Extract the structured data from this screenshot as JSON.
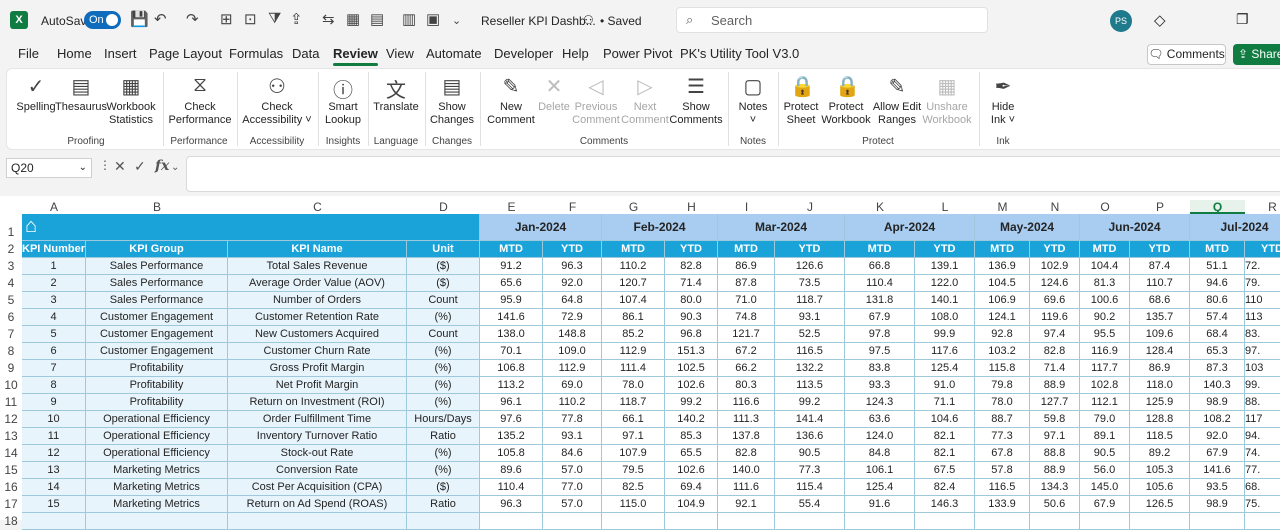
{
  "titlebar": {
    "autosave": "AutoSave",
    "toggle": "On",
    "doc_title": "Reseller KPI Dashb...",
    "saved": "• Saved",
    "search_placeholder": "Search",
    "avatar": "PS"
  },
  "menu": [
    "File",
    "Home",
    "Insert",
    "Page Layout",
    "Formulas",
    "Data",
    "Review",
    "View",
    "Automate",
    "Developer",
    "Help",
    "Power Pivot",
    "PK's Utility Tool V3.0"
  ],
  "active_menu": "Review",
  "comments_btn": "Comments",
  "share_btn": "Share",
  "ribbon": {
    "buttons": [
      {
        "l1": "Spelling",
        "l2": "",
        "dis": false
      },
      {
        "l1": "Thesaurus",
        "l2": "",
        "dis": false
      },
      {
        "l1": "Workbook",
        "l2": "Statistics",
        "dis": false
      },
      {
        "l1": "Check",
        "l2": "Performance",
        "dis": false
      },
      {
        "l1": "Check",
        "l2": "Accessibility ˅",
        "dis": false
      },
      {
        "l1": "Smart",
        "l2": "Lookup",
        "dis": false
      },
      {
        "l1": "Translate",
        "l2": "",
        "dis": false
      },
      {
        "l1": "Show",
        "l2": "Changes",
        "dis": false
      },
      {
        "l1": "New",
        "l2": "Comment",
        "dis": false
      },
      {
        "l1": "Delete",
        "l2": "",
        "dis": true
      },
      {
        "l1": "Previous",
        "l2": "Comment",
        "dis": true
      },
      {
        "l1": "Next",
        "l2": "Comment",
        "dis": true
      },
      {
        "l1": "Show",
        "l2": "Comments",
        "dis": false
      },
      {
        "l1": "Notes",
        "l2": "˅",
        "dis": false
      },
      {
        "l1": "Protect",
        "l2": "Sheet",
        "dis": false
      },
      {
        "l1": "Protect",
        "l2": "Workbook",
        "dis": false
      },
      {
        "l1": "Allow Edit",
        "l2": "Ranges",
        "dis": false
      },
      {
        "l1": "Unshare",
        "l2": "Workbook",
        "dis": true
      },
      {
        "l1": "Hide",
        "l2": "Ink ˅",
        "dis": false
      }
    ],
    "groups": [
      "Proofing",
      "Performance",
      "Accessibility",
      "Insights",
      "Language",
      "Changes",
      "Comments",
      "Notes",
      "Protect",
      "Ink"
    ]
  },
  "formula": {
    "namebox": "Q20",
    "fx": "fx",
    "value": ""
  },
  "columns": [
    "A",
    "B",
    "C",
    "D",
    "E",
    "F",
    "G",
    "H",
    "I",
    "J",
    "K",
    "L",
    "M",
    "N",
    "O",
    "P",
    "Q",
    "R"
  ],
  "selected_column": "Q",
  "rows": [
    "1",
    "2",
    "3",
    "4",
    "5",
    "6",
    "7",
    "8",
    "9",
    "10",
    "11",
    "12",
    "13",
    "14",
    "15",
    "16",
    "17",
    "18"
  ],
  "table": {
    "headers": [
      "KPI Number",
      "KPI Group",
      "KPI Name",
      "Unit"
    ],
    "months": [
      "Jan-2024",
      "Feb-2024",
      "Mar-2024",
      "Apr-2024",
      "May-2024",
      "Jun-2024",
      "Jul-2024"
    ],
    "sub": [
      "MTD",
      "YTD"
    ],
    "data": [
      [
        "1",
        "Sales Performance",
        "Total Sales Revenue",
        "($)",
        "91.2",
        "96.3",
        "110.2",
        "82.8",
        "86.9",
        "126.6",
        "66.8",
        "139.1",
        "136.9",
        "102.9",
        "104.4",
        "87.4",
        "51.1",
        "72."
      ],
      [
        "2",
        "Sales Performance",
        "Average Order Value (AOV)",
        "($)",
        "65.6",
        "92.0",
        "120.7",
        "71.4",
        "87.8",
        "73.5",
        "110.4",
        "122.0",
        "104.5",
        "124.6",
        "81.3",
        "110.7",
        "94.6",
        "79."
      ],
      [
        "3",
        "Sales Performance",
        "Number of Orders",
        "Count",
        "95.9",
        "64.8",
        "107.4",
        "80.0",
        "71.0",
        "118.7",
        "131.8",
        "140.1",
        "106.9",
        "69.6",
        "100.6",
        "68.6",
        "80.6",
        "110"
      ],
      [
        "4",
        "Customer Engagement",
        "Customer Retention Rate",
        "(%)",
        "141.6",
        "72.9",
        "86.1",
        "90.3",
        "74.8",
        "93.1",
        "67.9",
        "108.0",
        "124.1",
        "119.6",
        "90.2",
        "135.7",
        "57.4",
        "113"
      ],
      [
        "5",
        "Customer Engagement",
        "New Customers Acquired",
        "Count",
        "138.0",
        "148.8",
        "85.2",
        "96.8",
        "121.7",
        "52.5",
        "97.8",
        "99.9",
        "92.8",
        "97.4",
        "95.5",
        "109.6",
        "68.4",
        "83."
      ],
      [
        "6",
        "Customer Engagement",
        "Customer Churn Rate",
        "(%)",
        "70.1",
        "109.0",
        "112.9",
        "151.3",
        "67.2",
        "116.5",
        "97.5",
        "117.6",
        "103.2",
        "82.8",
        "116.9",
        "128.4",
        "65.3",
        "97."
      ],
      [
        "7",
        "Profitability",
        "Gross Profit Margin",
        "(%)",
        "106.8",
        "112.9",
        "111.4",
        "102.5",
        "66.2",
        "132.2",
        "83.8",
        "125.4",
        "115.8",
        "71.4",
        "117.7",
        "86.9",
        "87.3",
        "103"
      ],
      [
        "8",
        "Profitability",
        "Net Profit Margin",
        "(%)",
        "113.2",
        "69.0",
        "78.0",
        "102.6",
        "80.3",
        "113.5",
        "93.3",
        "91.0",
        "79.8",
        "88.9",
        "102.8",
        "118.0",
        "140.3",
        "99."
      ],
      [
        "9",
        "Profitability",
        "Return on Investment (ROI)",
        "(%)",
        "96.1",
        "110.2",
        "118.7",
        "99.2",
        "116.6",
        "99.2",
        "124.3",
        "71.1",
        "78.0",
        "127.7",
        "112.1",
        "125.9",
        "98.9",
        "88."
      ],
      [
        "10",
        "Operational Efficiency",
        "Order Fulfillment Time",
        "Hours/Days",
        "97.6",
        "77.8",
        "66.1",
        "140.2",
        "111.3",
        "141.4",
        "63.6",
        "104.6",
        "88.7",
        "59.8",
        "79.0",
        "128.8",
        "108.2",
        "117"
      ],
      [
        "11",
        "Operational Efficiency",
        "Inventory Turnover Ratio",
        "Ratio",
        "135.2",
        "93.1",
        "97.1",
        "85.3",
        "137.8",
        "136.6",
        "124.0",
        "82.1",
        "77.3",
        "97.1",
        "89.1",
        "118.5",
        "92.0",
        "94."
      ],
      [
        "12",
        "Operational Efficiency",
        "Stock-out Rate",
        "(%)",
        "105.8",
        "84.6",
        "107.9",
        "65.5",
        "82.8",
        "90.5",
        "84.8",
        "82.1",
        "67.8",
        "88.8",
        "90.5",
        "89.2",
        "67.9",
        "74."
      ],
      [
        "13",
        "Marketing Metrics",
        "Conversion Rate",
        "(%)",
        "89.6",
        "57.0",
        "79.5",
        "102.6",
        "140.0",
        "77.3",
        "106.1",
        "67.5",
        "57.8",
        "88.9",
        "56.0",
        "105.3",
        "141.6",
        "77."
      ],
      [
        "14",
        "Marketing Metrics",
        "Cost Per Acquisition (CPA)",
        "($)",
        "110.4",
        "77.0",
        "82.5",
        "69.4",
        "111.6",
        "115.4",
        "125.4",
        "82.4",
        "116.5",
        "134.3",
        "145.0",
        "105.6",
        "93.5",
        "68."
      ],
      [
        "15",
        "Marketing Metrics",
        "Return on Ad Spend (ROAS)",
        "Ratio",
        "96.3",
        "57.0",
        "115.0",
        "104.9",
        "92.1",
        "55.4",
        "91.6",
        "146.3",
        "133.9",
        "50.6",
        "67.9",
        "126.5",
        "98.9",
        "75."
      ],
      [
        "",
        "",
        "",
        "",
        "",
        "",
        "",
        "",
        "",
        "",
        "",
        "",
        "",
        "",
        "",
        "",
        "",
        ""
      ]
    ]
  },
  "colors": {
    "header_blue": "#1aa3d9",
    "month_blue": "#a9cdf0",
    "light_row": "#e8f4fb",
    "excel_green": "#107c41"
  }
}
